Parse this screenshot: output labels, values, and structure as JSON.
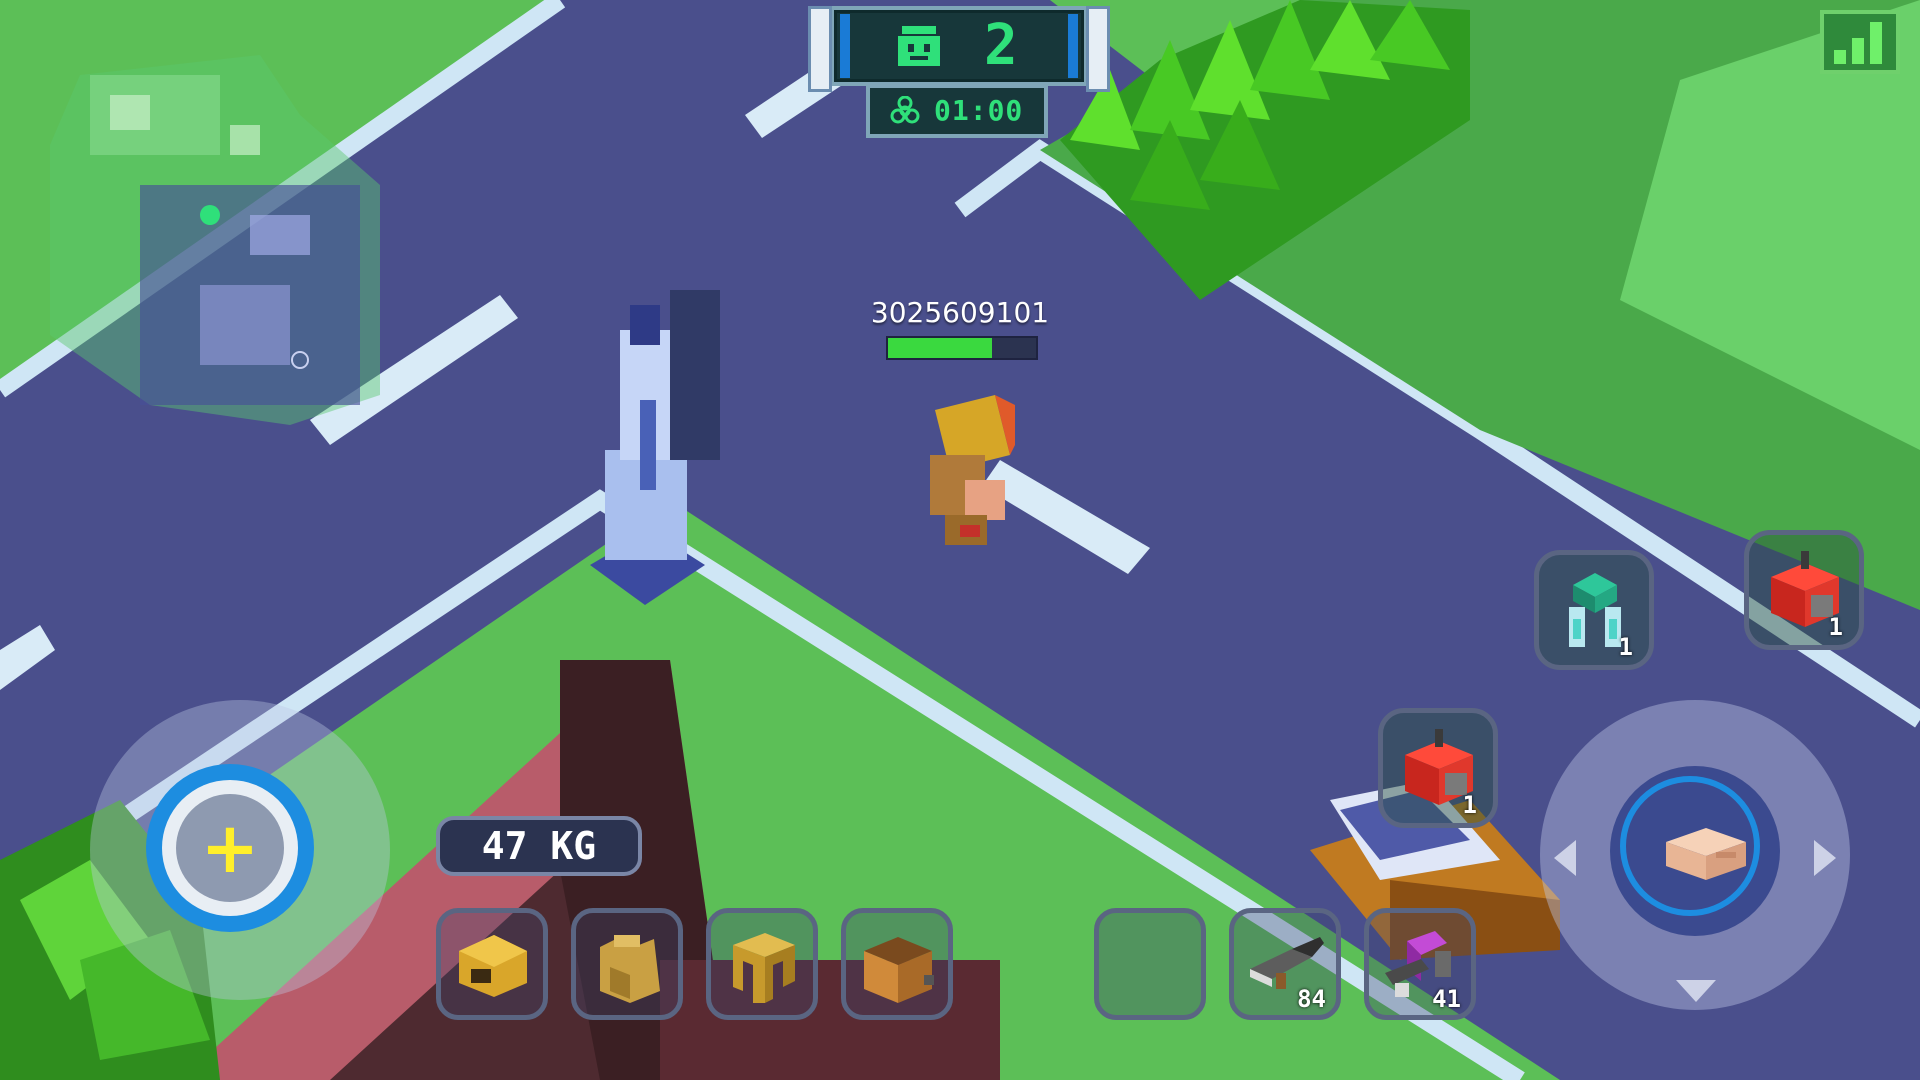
{
  "hud": {
    "survivors_remaining": "2",
    "timer": "01:00",
    "player_name": "3025609101",
    "player_health_fraction": 0.7,
    "carry_weight": "47 KG"
  },
  "icons": {
    "top_survivor": "survivor-face-icon",
    "timer": "biohazard-icon",
    "signal": "signal-strength-icon",
    "move": "plus-icon",
    "attack": "fist-icon"
  },
  "equipment_slots": [
    {
      "name": "helmet",
      "icon": "helmet-icon"
    },
    {
      "name": "vest",
      "icon": "vest-icon"
    },
    {
      "name": "pants",
      "icon": "pants-icon"
    },
    {
      "name": "backpack",
      "icon": "backpack-icon"
    }
  ],
  "weapon_slots": [
    {
      "name": "empty",
      "icon": "",
      "count": ""
    },
    {
      "name": "shotgun",
      "icon": "shotgun-icon",
      "count": "84"
    },
    {
      "name": "blaster",
      "icon": "blaster-icon",
      "count": "41"
    }
  ],
  "skills": {
    "shield_count": "1",
    "mine_top_count": "1",
    "mine_bottom_count": "1"
  },
  "colors": {
    "grass": "#5cbf57",
    "road": "#4a4f8c",
    "road_edge": "#cfe6f5",
    "hud_text": "#2fe07a",
    "health": "#3ad93f"
  }
}
